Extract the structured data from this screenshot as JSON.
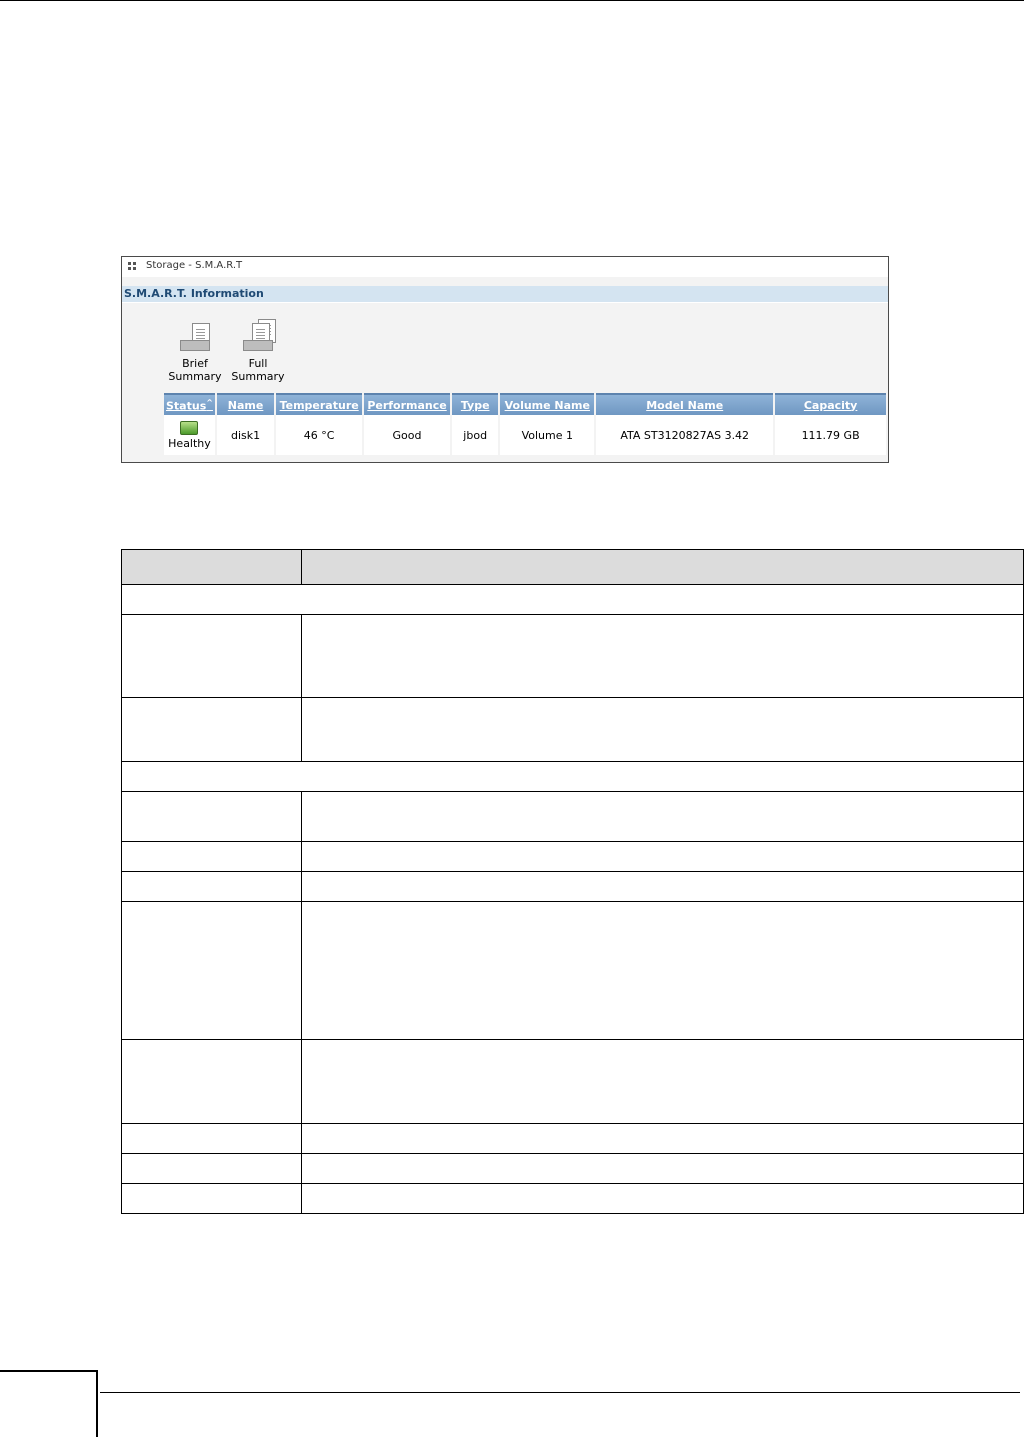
{
  "panel": {
    "title": "Storage - S.M.A.R.T",
    "section": "S.M.A.R.T. Information",
    "buttons": {
      "brief_line1": "Brief",
      "brief_line2": "Summary",
      "full_line1": "Full",
      "full_line2": "Summary"
    },
    "table": {
      "headers": [
        "Status",
        "Name",
        "Temperature",
        "Performance",
        "Type",
        "Volume Name",
        "Model Name",
        "Capacity"
      ],
      "row": {
        "status": "Healthy",
        "name": "disk1",
        "temperature": "46 °C",
        "performance": "Good",
        "type": "jbod",
        "volume_name": "Volume 1",
        "model_name": "ATA ST3120827AS 3.42",
        "capacity": "111.79 GB"
      }
    }
  }
}
